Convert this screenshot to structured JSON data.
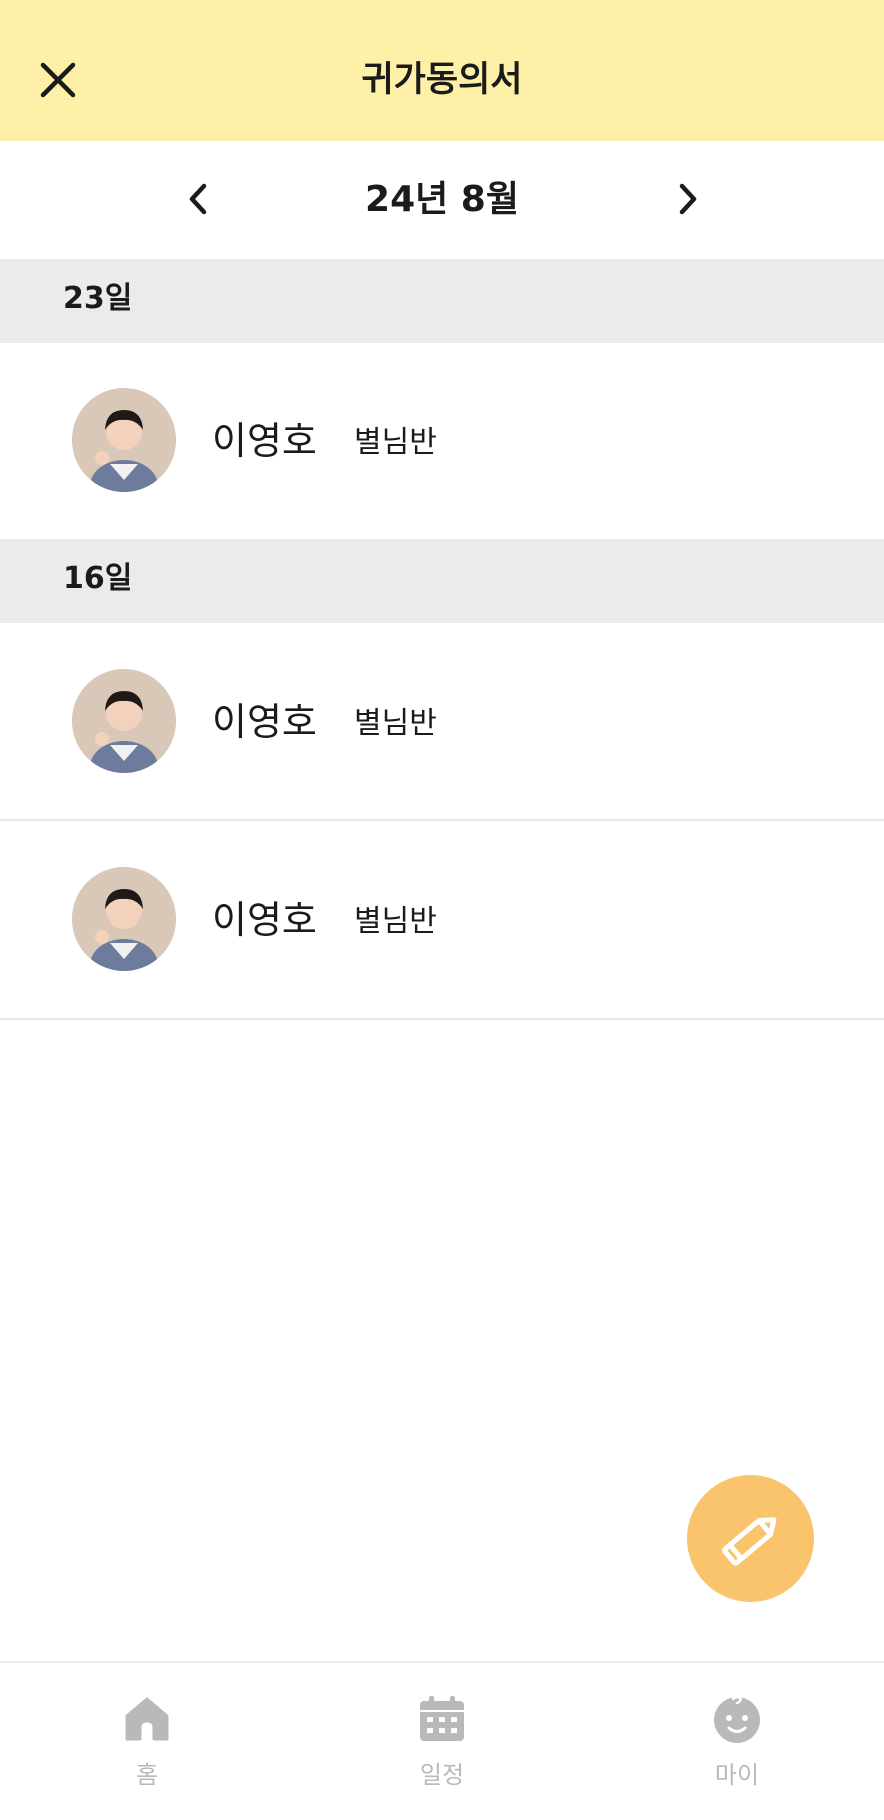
{
  "header": {
    "title": "귀가동의서",
    "background_color": "#FEF0A6",
    "close_icon": "close-icon"
  },
  "month_nav": {
    "label": "24년 8월",
    "prev_icon": "chevron-left-icon",
    "next_icon": "chevron-right-icon"
  },
  "days": [
    {
      "label": "23일",
      "entries": [
        {
          "name": "이영호",
          "class_name": "별님반"
        }
      ]
    },
    {
      "label": "16일",
      "entries": [
        {
          "name": "이영호",
          "class_name": "별님반"
        },
        {
          "name": "이영호",
          "class_name": "별님반"
        }
      ]
    }
  ],
  "fab": {
    "icon": "pencil-icon",
    "color": "#F9C46C"
  },
  "tabbar": {
    "tabs": [
      {
        "label": "홈",
        "icon": "home-icon"
      },
      {
        "label": "일정",
        "icon": "calendar-icon"
      },
      {
        "label": "마이",
        "icon": "baby-face-icon"
      }
    ],
    "inactive_color": "#B9B9B9"
  }
}
